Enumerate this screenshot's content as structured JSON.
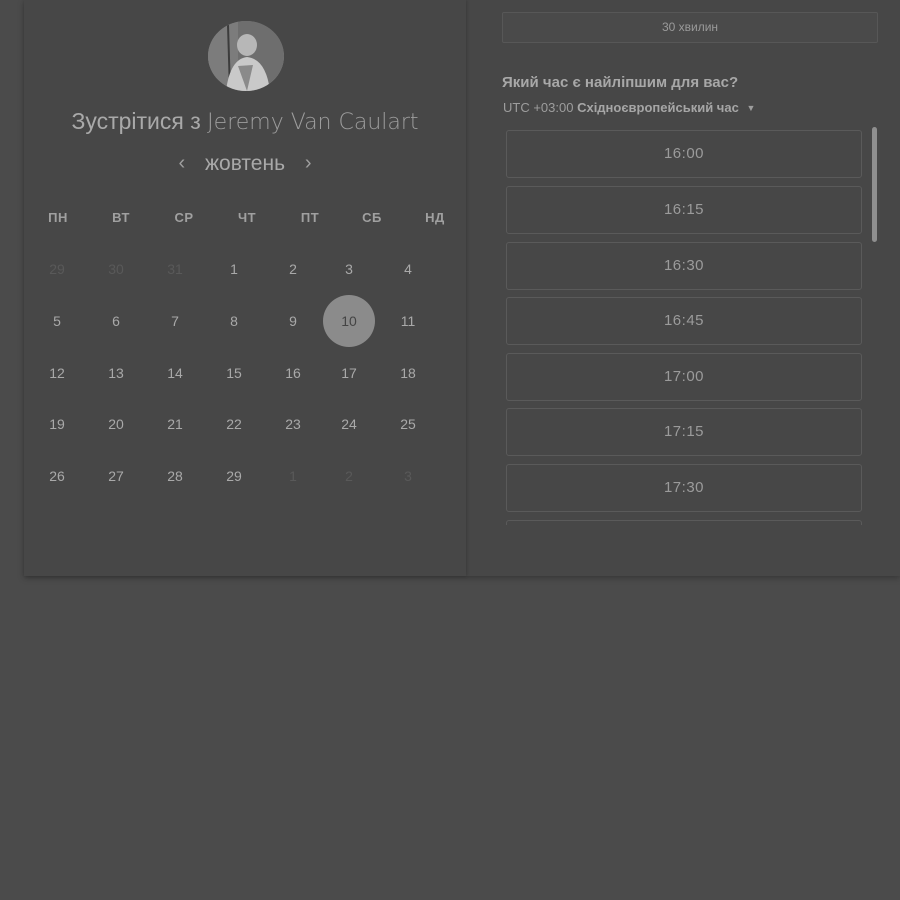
{
  "header": {
    "title_prefix": "Зустрітися з",
    "host_name": "Jeremy Van Caulart"
  },
  "calendar": {
    "month": "жовтень",
    "prev_icon": "chevron-left-icon",
    "next_icon": "chevron-right-icon",
    "weekdays": [
      "ПН",
      "ВТ",
      "СР",
      "ЧТ",
      "ПТ",
      "СБ",
      "НД"
    ],
    "weeks": [
      [
        "29",
        "30",
        "31",
        "1",
        "2",
        "3",
        "4"
      ],
      [
        "5",
        "6",
        "7",
        "8",
        "9",
        "10",
        "11"
      ],
      [
        "12",
        "13",
        "14",
        "15",
        "16",
        "17",
        "18"
      ],
      [
        "19",
        "20",
        "21",
        "22",
        "23",
        "24",
        "25"
      ],
      [
        "26",
        "27",
        "28",
        "29",
        "1",
        "2",
        "3"
      ]
    ],
    "muted_days": [
      [
        0,
        0
      ],
      [
        0,
        1
      ],
      [
        0,
        2
      ],
      [
        4,
        4
      ],
      [
        4,
        5
      ],
      [
        4,
        6
      ]
    ],
    "selected_day": "10"
  },
  "duration": {
    "label": "30 хвилин"
  },
  "scheduler": {
    "question": "Який час є найліпшим для вас?",
    "timezone_offset": "UTC +03:00",
    "timezone_name": "Східноєвропейський час",
    "timezone_icon": "caret-down-icon",
    "time_slots": [
      "16:00",
      "16:15",
      "16:30",
      "16:45",
      "17:00",
      "17:15",
      "17:30",
      ""
    ]
  },
  "colors": {
    "background": "#4b4b4b",
    "panel": "#474747",
    "selected_day": "#8b8b8b",
    "text": "#a9a9a9",
    "muted_text": "#595959"
  }
}
